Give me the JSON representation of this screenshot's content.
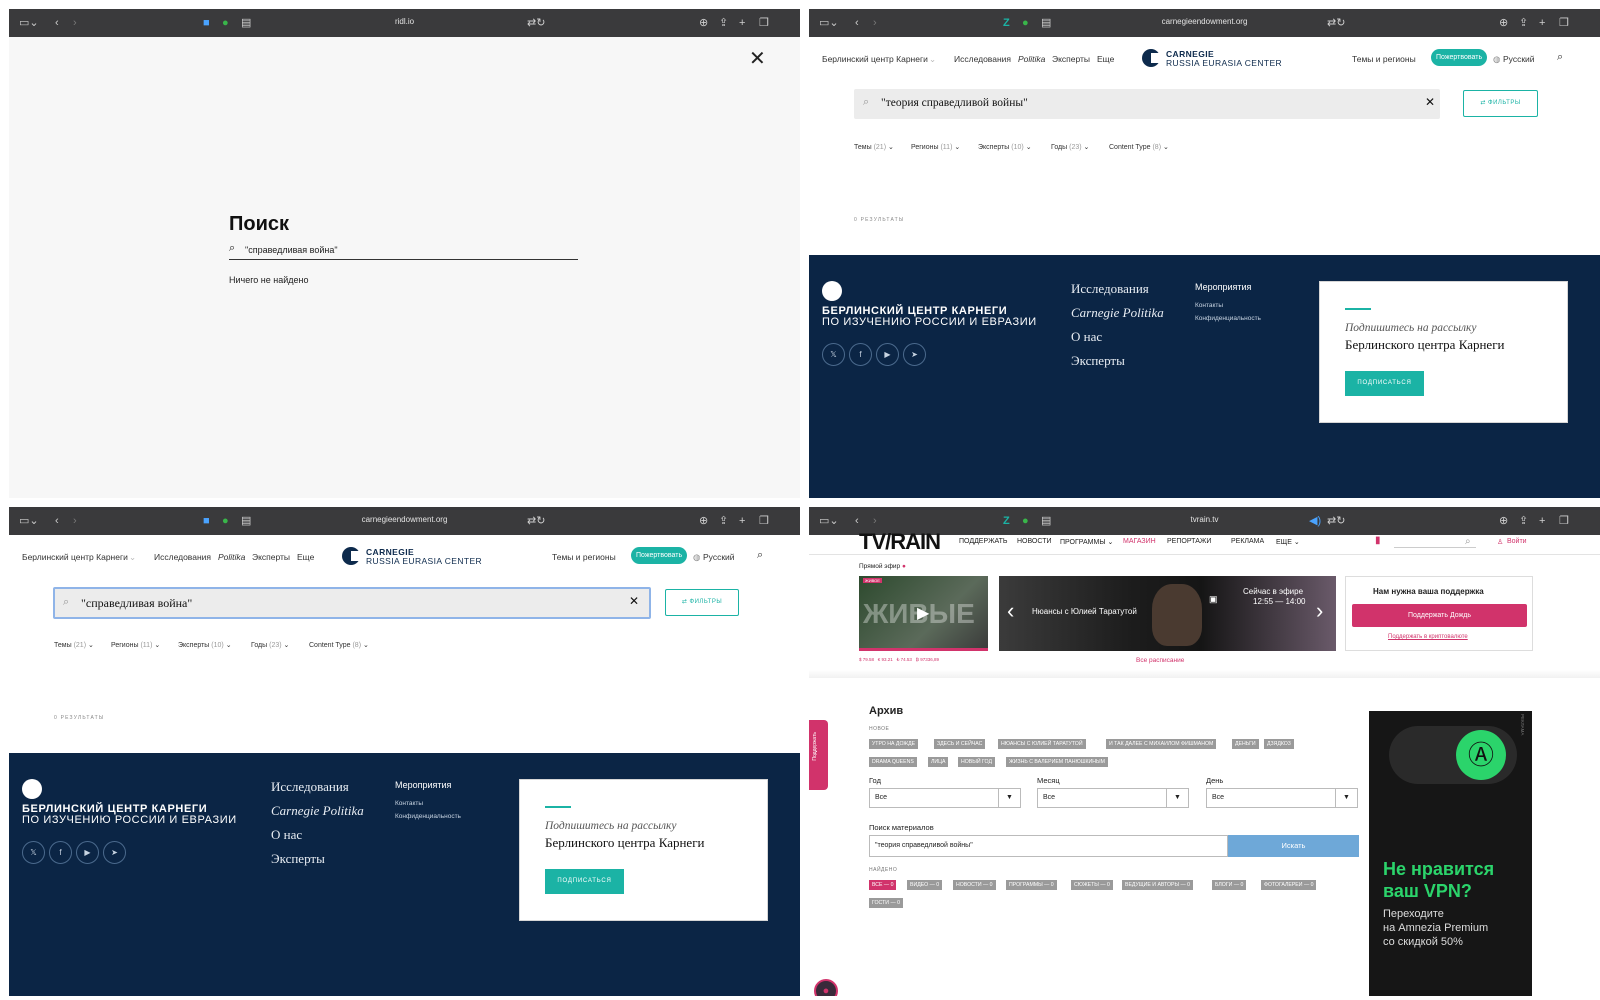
{
  "panel1": {
    "url": "ridl.io",
    "title": "Поиск",
    "search_value": "\"справедливая война\"",
    "empty_text": "Ничего не найдено"
  },
  "carnegie_nav": {
    "home": "Берлинский центр Карнеги",
    "research": "Исследования",
    "politika": "Politika",
    "experts": "Эксперты",
    "more": "Еще",
    "logo_line1": "CARNEGIE",
    "logo_line2": "RUSSIA EURASIA CENTER",
    "topics": "Темы и регионы",
    "donate": "Пожертвовать",
    "language": "Русский"
  },
  "carnegie_facets": {
    "topics": "Темы",
    "topics_count": "(21)",
    "regions": "Регионы",
    "regions_count": "(11)",
    "experts": "Эксперты",
    "experts_count": "(10)",
    "years": "Годы",
    "years_count": "(23)",
    "content_type": "Content Type",
    "content_type_count": "(8)",
    "filters": "ФИЛЬТРЫ",
    "results": "0 РЕЗУЛЬТАТЫ"
  },
  "carnegie_footer": {
    "name1": "БЕРЛИНСКИЙ ЦЕНТР КАРНЕГИ",
    "name2": "ПО ИЗУЧЕНИЮ РОССИИ И ЕВРАЗИИ",
    "social": [
      "𝕏",
      "f",
      "▶",
      "➤"
    ],
    "link_research": "Исследования",
    "link_politika": "Carnegie Politika",
    "link_about": "О нас",
    "link_experts": "Эксперты",
    "events": "Мероприятия",
    "contacts": "Контакты",
    "privacy": "Конфиденциальность",
    "subscribe_line1": "Подпишитесь на рассылку",
    "subscribe_line2": "Берлинского центра Карнеги",
    "subscribe_button": "ПОДПИСАТЬСЯ"
  },
  "panel2": {
    "url": "carnegieendowment.org",
    "search_value": "\"теория справедливой войны\""
  },
  "panel3": {
    "url": "carnegieendowment.org",
    "search_value": "\"справедливая война\""
  },
  "panel4": {
    "url": "tvrain.tv",
    "logo": "TV/RAIN",
    "nav": [
      "ПОДДЕРЖАТЬ",
      "НОВОСТИ",
      "ПРОГРАММЫ ⌄",
      "МАГАЗИН",
      "РЕПОРТАЖИ",
      "РЕКЛАМА",
      "ЕЩЕ ⌄"
    ],
    "login": "Войти",
    "live_label": "Прямой эфир",
    "live_badge": "ЖИВОЕ",
    "thumb_text": "ЖИВЫЕ",
    "rates": [
      "$ 79.58",
      "€ 93.21",
      "₺ 74.53",
      "₿ 97336,89"
    ],
    "show_title": "Нюансы с Юлией Таратутой",
    "now_on_air": "Сейчас в эфире",
    "now_time": "12:55 — 14:00",
    "schedule_link": "Все расписание",
    "support_title": "Нам нужна ваша поддержка",
    "support_button": "Поддержать Дождь",
    "support_crypto": "Поддержать в криптовалюте",
    "side_tab": "Поддержать",
    "archive_title": "Архив",
    "new_label": "НОВОЕ",
    "tags_row1": [
      "УТРО НА ДОЖДЕ",
      "ЗДЕСЬ И СЕЙЧАС",
      "НЮАНСЫ С ЮЛИЕЙ ТАРАТУТОЙ",
      "И ТАК ДАЛЕЕ С МИХАИЛОМ ФИШМАНОМ",
      "ДЕНЬГИ",
      "ДЗЯДКО3"
    ],
    "tags_row2": [
      "DRAMA QUEENS",
      "ЛИЦА",
      "НОВЫЙ ГОД",
      "ЖИЗНЬ С ВАЛЕРИЕМ ПАНЮШКИНЫМ"
    ],
    "year_label": "Год",
    "month_label": "Месяц",
    "day_label": "День",
    "year_value": "Все",
    "month_value": "Все",
    "day_value": "Все",
    "search_label": "Поиск материалов",
    "search_value": "\"теория справедливой войны\"",
    "search_button": "Искать",
    "found_label": "НАЙДЕНО",
    "found_tags": [
      "ВСЕ — 0",
      "ВИДЕО — 0",
      "НОВОСТИ — 0",
      "ПРОГРАММЫ — 0",
      "СЮЖЕТЫ — 0",
      "ВЕДУЩИЕ И АВТОРЫ — 0",
      "БЛОГИ — 0",
      "ФОТОГАЛЕРЕИ — 0"
    ],
    "found_tags2": [
      "ГОСТИ — 0"
    ],
    "ad_label": "РЕКЛАМА",
    "ad_title1": "Не нравится",
    "ad_title2": "ваш VPN?",
    "ad_text1": "Переходите",
    "ad_text2": "на Amnezia Premium",
    "ad_text3": "со скидкой 50%"
  },
  "colors": {
    "teal": "#1bb3a5",
    "navy": "#0b2545",
    "rain_pink": "#d1336b",
    "ad_green": "#2bd46b"
  }
}
